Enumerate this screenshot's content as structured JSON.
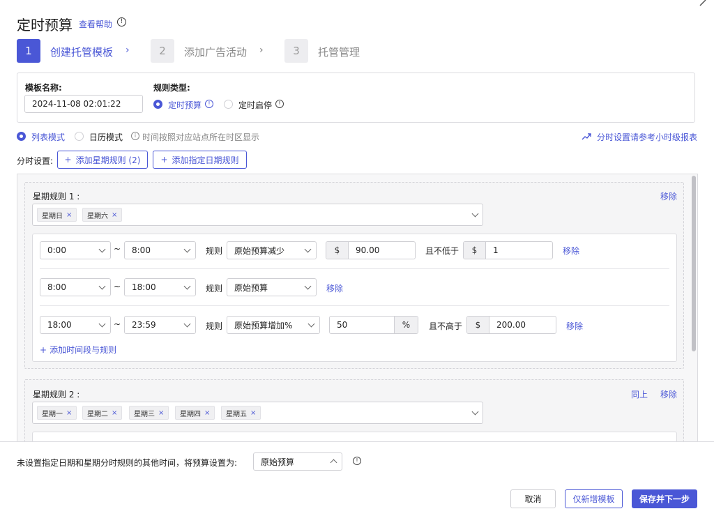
{
  "header": {
    "title": "定时预算",
    "help_link": "查看帮助"
  },
  "steps": [
    {
      "num": "1",
      "label": "创建托管模板"
    },
    {
      "num": "2",
      "label": "添加广告活动"
    },
    {
      "num": "3",
      "label": "托管管理"
    }
  ],
  "template": {
    "name_label": "模板名称:",
    "name_value": "2024-11-08 02:01:22",
    "type_label": "规则类型:",
    "type_options": [
      "定时预算",
      "定时启停"
    ],
    "selected_type": "定时预算"
  },
  "mode": {
    "options": [
      "列表模式",
      "日历模式"
    ],
    "selected": "列表模式",
    "note": "时间按照对应站点所在时区显示",
    "report_link": "分时设置请参考小时级报表"
  },
  "schedule": {
    "label": "分时设置:",
    "add_week_rule": "添加星期规则 (2)",
    "add_date_rule": "添加指定日期规则"
  },
  "week_rules": [
    {
      "title": "星期规则 1 :",
      "remove": "移除",
      "days": [
        "星期日",
        "星期六"
      ],
      "rows": [
        {
          "start": "0:00",
          "end": "8:00",
          "rule_label": "规则",
          "rule": "原始预算减少",
          "amount_prefix": "$",
          "amount": "90.00",
          "limit_label": "且不低于",
          "limit_prefix": "$",
          "limit": "1",
          "remove": "移除"
        },
        {
          "start": "8:00",
          "end": "18:00",
          "rule_label": "规则",
          "rule": "原始预算",
          "remove": "移除"
        },
        {
          "start": "18:00",
          "end": "23:59",
          "rule_label": "规则",
          "rule": "原始预算增加%",
          "amount": "50",
          "amount_suffix": "%",
          "limit_label": "且不高于",
          "limit_prefix": "$",
          "limit": "200.00",
          "remove": "移除"
        }
      ],
      "add_row": "添加时间段与规则"
    },
    {
      "title": "星期规则 2 :",
      "same_as_above": "同上",
      "remove": "移除",
      "days": [
        "星期一",
        "星期二",
        "星期三",
        "星期四",
        "星期五"
      ]
    }
  ],
  "footer": {
    "other_time_label": "未设置指定日期和星期分时规则的其他时间，将预算设置为:",
    "other_time_value": "原始预算",
    "cancel": "取消",
    "save_template": "仅新增模板",
    "save_next": "保存并下一步"
  }
}
